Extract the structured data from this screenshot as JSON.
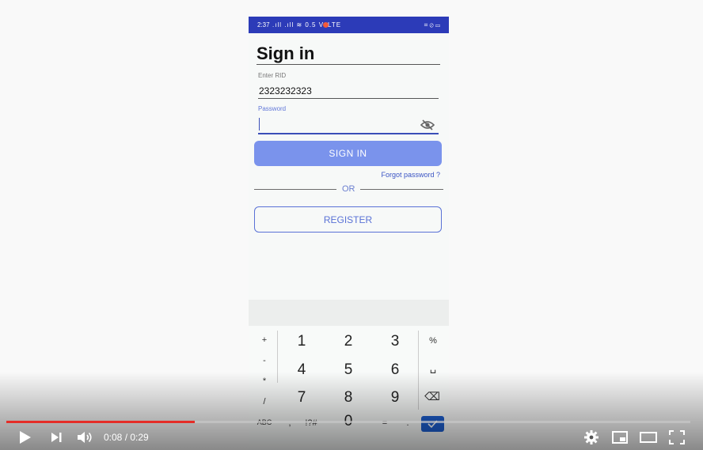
{
  "status_bar": {
    "time": "2:37",
    "signal": ".ıll .ıll ≋ 0.5 VoLTE",
    "right_icons": "⌗ ⊘ ▭"
  },
  "form": {
    "title": "Sign in",
    "rid_label": "Enter RID",
    "rid_value": "2323232323",
    "password_label": "Password",
    "password_value": "",
    "sign_in_label": "SIGN IN",
    "forgot_label": "Forgot password ?",
    "or_label": "OR",
    "register_label": "REGISTER"
  },
  "keyboard": {
    "left": [
      "+",
      "-",
      "*",
      "/",
      "ABC"
    ],
    "digits": [
      "1",
      "2",
      "3",
      "4",
      "5",
      "6",
      "7",
      "8",
      "9",
      "0"
    ],
    "right": [
      "%",
      "␣",
      "⌫"
    ],
    "bottom": [
      ",",
      "!?#",
      "=",
      "."
    ]
  },
  "player": {
    "time_display": "0:08 / 0:29",
    "progress_fraction": 0.276,
    "accent_color": "#e52d27"
  }
}
